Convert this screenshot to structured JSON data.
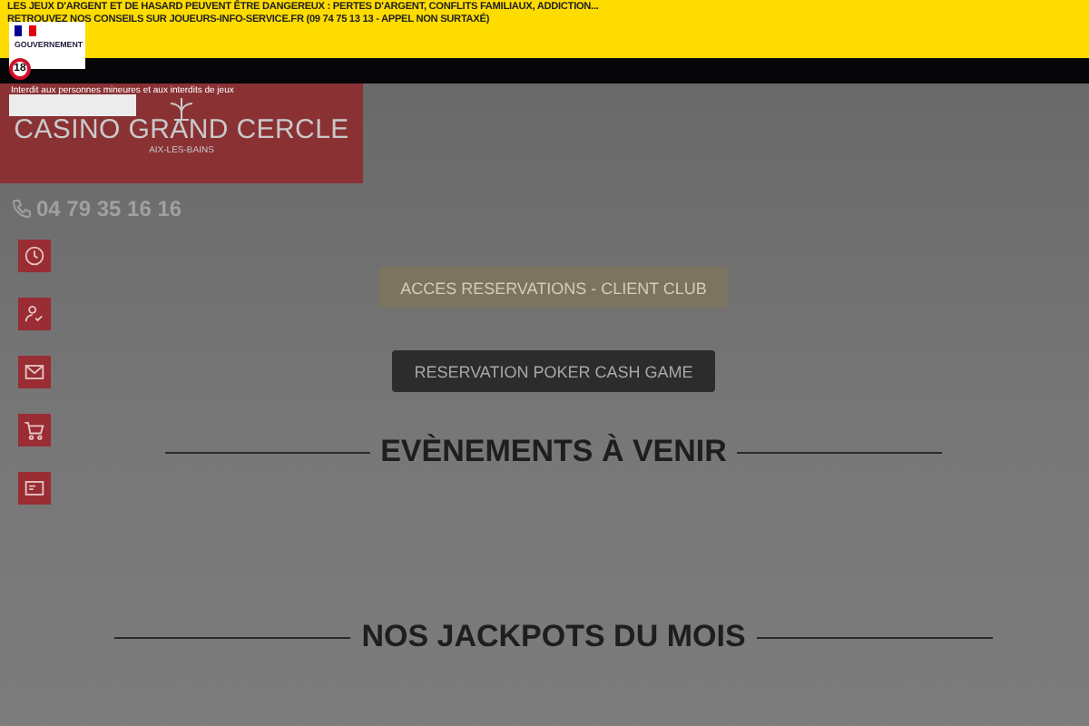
{
  "warning_banner": {
    "lines": [
      "LES JEUX D'ARGENT ET DE HASARD PEUVENT ÊTRE DANGEREUX : PERTES D'ARGENT, CONFLITS FAMILIAUX, ADDICTION...",
      "RETROUVEZ NOS CONSEILS SUR JOUEURS-INFO-SERVICE.FR (09 74 75 13 13 - APPEL NON SURTAXÉ)"
    ],
    "gov_logo": "GOUVERNEMENT",
    "age_badge": "18"
  },
  "age_notice": "Interdit aux personnes mineures et aux interdits de jeux",
  "logo": {
    "name": "CASINO GRAND CERCLE",
    "city": "AIX-LES-BAINS"
  },
  "phone": "04 79 35 16 16",
  "side_icons": [
    {
      "kind": "clock"
    },
    {
      "kind": "user-check"
    },
    {
      "kind": "mail"
    },
    {
      "kind": "cart"
    },
    {
      "kind": "card"
    }
  ],
  "buttons": [
    {
      "label": "ACCES RESERVATIONS - CLIENT CLUB",
      "kind": "beige"
    },
    {
      "label": "RESERVATION POKER CASH GAME",
      "kind": "dark"
    }
  ],
  "sections": [
    "EVÈNEMENTS À VENIR",
    "NOS JACKPOTS DU MOIS"
  ]
}
